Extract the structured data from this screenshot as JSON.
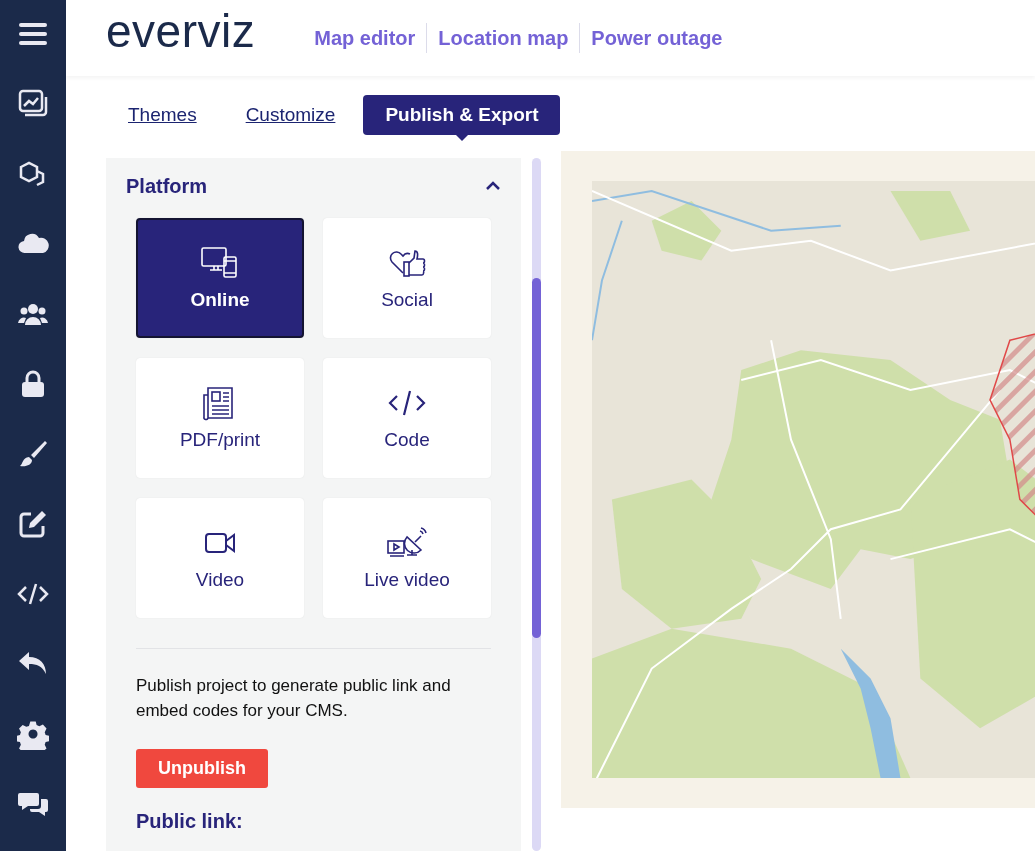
{
  "logo": "everviz",
  "nav": [
    {
      "label": "Map editor"
    },
    {
      "label": "Location map"
    },
    {
      "label": "Power outage"
    }
  ],
  "tabs": [
    {
      "label": "Themes",
      "selected": false
    },
    {
      "label": "Customize",
      "selected": false
    },
    {
      "label": "Publish & Export",
      "selected": true
    }
  ],
  "panel": {
    "title": "Platform",
    "expanded": true,
    "platforms": [
      {
        "label": "Online",
        "selected": true
      },
      {
        "label": "Social",
        "selected": false
      },
      {
        "label": "PDF/print",
        "selected": false
      },
      {
        "label": "Code",
        "selected": false
      },
      {
        "label": "Video",
        "selected": false
      },
      {
        "label": "Live video",
        "selected": false
      }
    ],
    "description": "Publish project to generate public link and embed codes for your CMS.",
    "unpublish_button": "Unpublish",
    "public_link_label": "Public link:"
  }
}
